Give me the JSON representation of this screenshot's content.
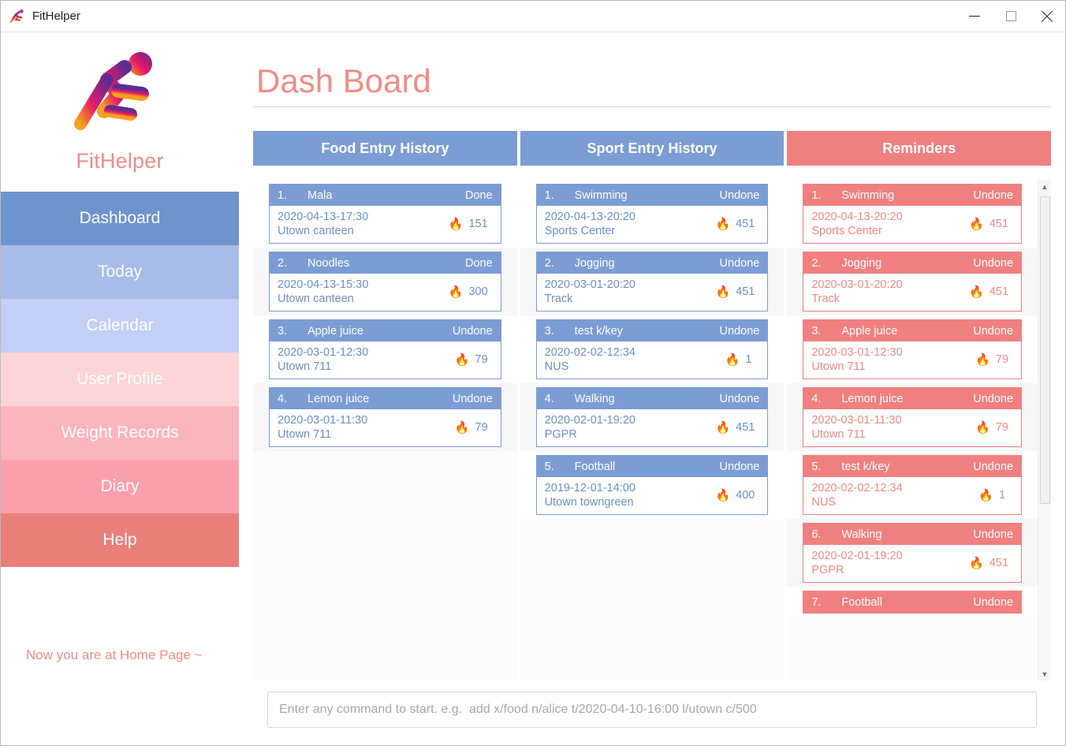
{
  "window": {
    "title": "FitHelper",
    "app_icon": "runner-icon",
    "controls": {
      "minimize": "minimize-icon",
      "maximize": "maximize-icon",
      "close": "close-icon"
    }
  },
  "sidebar": {
    "logo_icon": "runner-logo-icon",
    "brand": "FitHelper",
    "status_note": "Now you are at Home Page ~",
    "items": [
      {
        "label": "Dashboard",
        "color": "#6e94cd"
      },
      {
        "label": "Today",
        "color": "#a8bce9"
      },
      {
        "label": "Calendar",
        "color": "#c3cff5"
      },
      {
        "label": "User Profile",
        "color": "#fcd5d6"
      },
      {
        "label": "Weight Records",
        "color": "#fbb5bd"
      },
      {
        "label": "Diary",
        "color": "#f9a0ac"
      },
      {
        "label": "Help",
        "color": "#ea7f7a"
      }
    ]
  },
  "main": {
    "page_title": "Dash Board",
    "tabs": [
      {
        "label": "Food Entry History",
        "style": "blue"
      },
      {
        "label": "Sport Entry History",
        "style": "blue"
      },
      {
        "label": "Reminders",
        "style": "red"
      }
    ]
  },
  "colors": {
    "blue": "#7b9dd4",
    "red": "#f08080",
    "title_pink": "#f08c85",
    "body_blue_text": "#6c8fc6",
    "body_red_text": "#ef8a84"
  },
  "columns": [
    {
      "name": "food-entry-history",
      "style": "blue",
      "entries": [
        {
          "index": "1.",
          "name": "Mala",
          "status": "Done",
          "datetime": "2020-04-13-17:30",
          "location": "Utown canteen",
          "calories": "151",
          "flame": "flame-icon"
        },
        {
          "index": "2.",
          "name": "Noodles",
          "status": "Done",
          "datetime": "2020-04-13-15:30",
          "location": "Utown canteen",
          "calories": "300",
          "flame": "flame-icon"
        },
        {
          "index": "3.",
          "name": "Apple juice",
          "status": "Undone",
          "datetime": "2020-03-01-12:30",
          "location": "Utown 711",
          "calories": "79",
          "flame": "flame-icon"
        },
        {
          "index": "4.",
          "name": "Lemon juice",
          "status": "Undone",
          "datetime": "2020-03-01-11:30",
          "location": "Utown 711",
          "calories": "79",
          "flame": "flame-icon"
        }
      ]
    },
    {
      "name": "sport-entry-history",
      "style": "blue",
      "entries": [
        {
          "index": "1.",
          "name": "Swimming",
          "status": "Undone",
          "datetime": "2020-04-13-20:20",
          "location": "Sports Center",
          "calories": "451",
          "flame": "flame-icon"
        },
        {
          "index": "2.",
          "name": "Jogging",
          "status": "Undone",
          "datetime": "2020-03-01-20:20",
          "location": "Track",
          "calories": "451",
          "flame": "flame-icon"
        },
        {
          "index": "3.",
          "name": "test k/key",
          "status": "Undone",
          "datetime": "2020-02-02-12:34",
          "location": "NUS",
          "calories": "1",
          "flame": "flame-icon"
        },
        {
          "index": "4.",
          "name": "Walking",
          "status": "Undone",
          "datetime": "2020-02-01-19:20",
          "location": "PGPR",
          "calories": "451",
          "flame": "flame-icon"
        },
        {
          "index": "5.",
          "name": "Football",
          "status": "Undone",
          "datetime": "2019-12-01-14:00",
          "location": "Utown towngreen",
          "calories": "400",
          "flame": "flame-icon"
        }
      ]
    },
    {
      "name": "reminders",
      "style": "red",
      "scrollbar": true,
      "entries": [
        {
          "index": "1.",
          "name": "Swimming",
          "status": "Undone",
          "datetime": "2020-04-13-20:20",
          "location": "Sports Center",
          "calories": "451",
          "flame": "flame-icon"
        },
        {
          "index": "2.",
          "name": "Jogging",
          "status": "Undone",
          "datetime": "2020-03-01-20:20",
          "location": "Track",
          "calories": "451",
          "flame": "flame-icon"
        },
        {
          "index": "3.",
          "name": "Apple juice",
          "status": "Undone",
          "datetime": "2020-03-01-12:30",
          "location": "Utown 711",
          "calories": "79",
          "flame": "flame-icon"
        },
        {
          "index": "4.",
          "name": "Lemon juice",
          "status": "Undone",
          "datetime": "2020-03-01-11:30",
          "location": "Utown 711",
          "calories": "79",
          "flame": "flame-icon"
        },
        {
          "index": "5.",
          "name": "test k/key",
          "status": "Undone",
          "datetime": "2020-02-02-12:34",
          "location": "NUS",
          "calories": "1",
          "flame": "flame-icon"
        },
        {
          "index": "6.",
          "name": "Walking",
          "status": "Undone",
          "datetime": "2020-02-01-19:20",
          "location": "PGPR",
          "calories": "451",
          "flame": "flame-icon"
        },
        {
          "index": "7.",
          "name": "Football",
          "status": "Undone",
          "datetime": "",
          "location": "",
          "calories": "",
          "flame": "flame-icon"
        }
      ]
    }
  ],
  "command_bar": {
    "value": "",
    "placeholder": "Enter any command to start. e.g.  add x/food n/alice t/2020-04-10-16:00 l/utown c/500"
  }
}
